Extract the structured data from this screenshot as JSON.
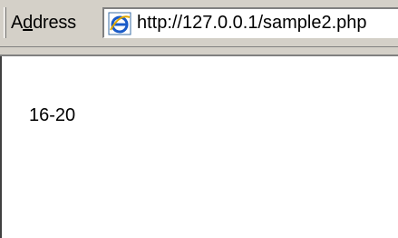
{
  "address_bar": {
    "label_prefix": "A",
    "label_mnemonic": "d",
    "label_suffix": "dress",
    "url": "http://127.0.0.1/sample2.php",
    "page_icon": "internet-explorer-page-icon"
  },
  "page": {
    "content_text": "16-20"
  },
  "colors": {
    "chrome_gray": "#d4d0c8",
    "ie_blue": "#1a5bc8"
  }
}
